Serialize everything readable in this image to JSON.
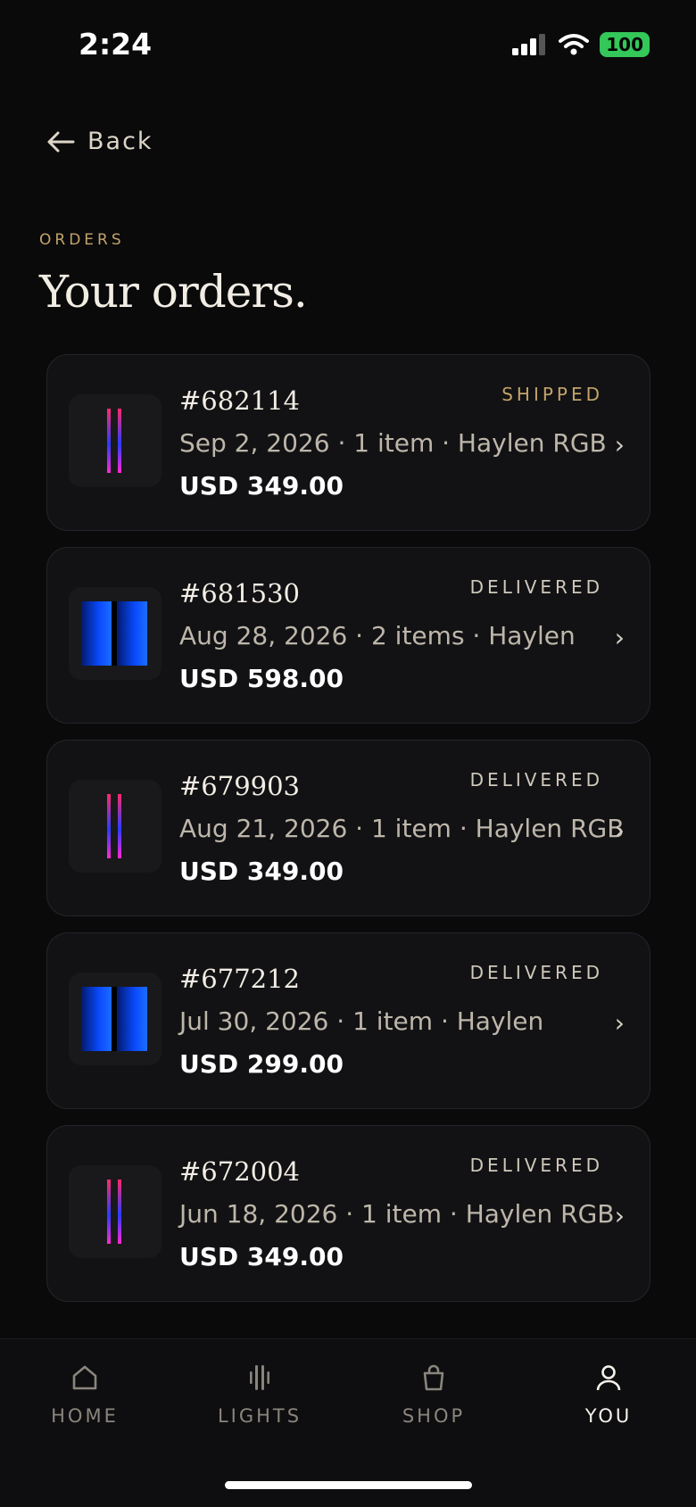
{
  "status_bar": {
    "time": "2:24",
    "battery": "100"
  },
  "nav": {
    "back_label": "Back"
  },
  "header": {
    "eyebrow": "ORDERS",
    "title": "Your orders."
  },
  "colors": {
    "accent": "#c2a36a",
    "shipped": "#c2a36a",
    "delivered": "#cfc8bb",
    "background": "#0a0a0b"
  },
  "orders": [
    {
      "number": "#682114",
      "status": "SHIPPED",
      "meta": "Sep 2, 2026 · 1 item · Haylen RGB",
      "price": "USD 349.00",
      "thumb": "rgb"
    },
    {
      "number": "#681530",
      "status": "DELIVERED",
      "meta": "Aug 28, 2026 · 2 items · Haylen",
      "price": "USD 598.00",
      "thumb": "blue"
    },
    {
      "number": "#679903",
      "status": "DELIVERED",
      "meta": "Aug 21, 2026 · 1 item · Haylen RGB",
      "price": "USD 349.00",
      "thumb": "rgb"
    },
    {
      "number": "#677212",
      "status": "DELIVERED",
      "meta": "Jul 30, 2026 · 1 item · Haylen",
      "price": "USD 299.00",
      "thumb": "blue"
    },
    {
      "number": "#672004",
      "status": "DELIVERED",
      "meta": "Jun 18, 2026 · 1 item · Haylen RGB",
      "price": "USD 349.00",
      "thumb": "rgb"
    }
  ],
  "tabs": [
    {
      "label": "HOME",
      "icon": "home-icon",
      "active": false
    },
    {
      "label": "LIGHTS",
      "icon": "lights-icon",
      "active": false
    },
    {
      "label": "SHOP",
      "icon": "bag-icon",
      "active": false
    },
    {
      "label": "YOU",
      "icon": "person-icon",
      "active": true
    }
  ]
}
